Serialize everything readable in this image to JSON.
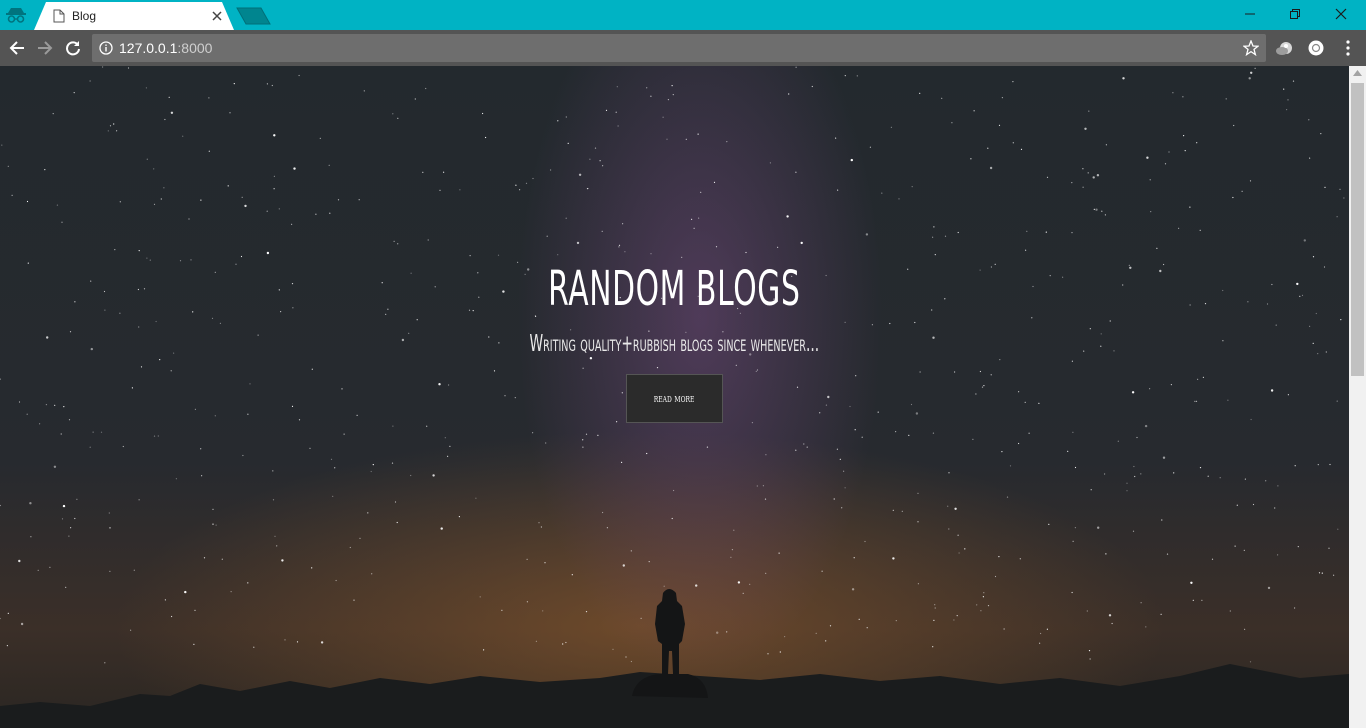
{
  "browser": {
    "tab_title": "Blog",
    "url_host": "127.0.0.1",
    "url_port": ":8000",
    "accent_color": "#00b3c4"
  },
  "icons": {
    "incognito": "incognito-icon",
    "page": "page-icon",
    "close_tab": "close-icon",
    "new_tab": "new-tab-icon",
    "minimize": "minimize-icon",
    "restore": "restore-icon",
    "close_window": "close-window-icon",
    "back": "back-arrow-icon",
    "forward": "forward-arrow-icon",
    "reload": "reload-icon",
    "site_info": "info-icon",
    "bookmark": "star-icon",
    "extension_1": "cloud-extension-icon",
    "extension_2": "profile-extension-icon",
    "menu": "kebab-menu-icon"
  },
  "hero": {
    "title": "RANDOM BLOGS",
    "subtitle": "Writing quality+rubbish blogs since whenever...",
    "button_label": "READ MORE"
  }
}
